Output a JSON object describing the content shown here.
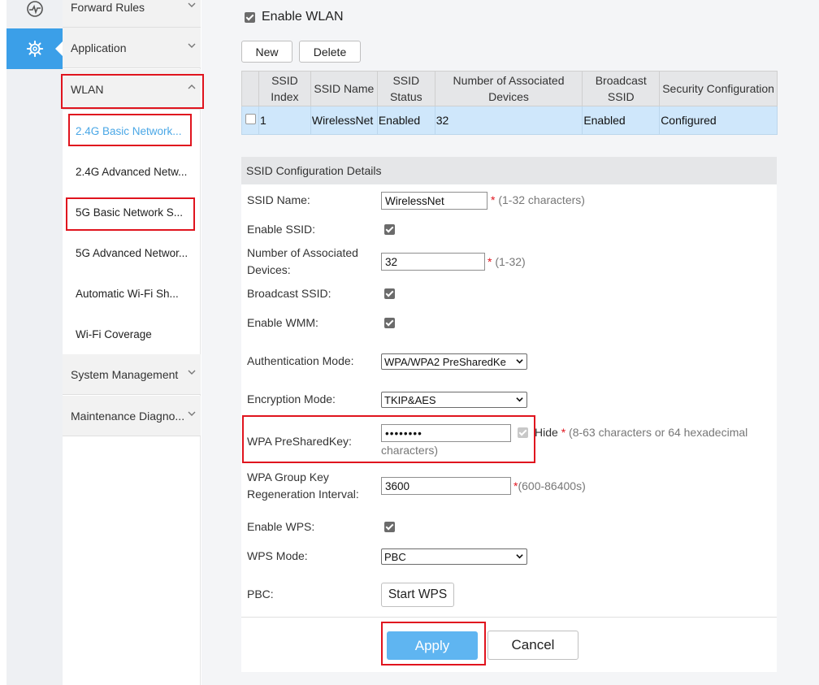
{
  "rail": {
    "items": [
      {
        "icon": "monitor-wave-icon"
      },
      {
        "icon": "gear-icon",
        "active": true
      }
    ]
  },
  "menu": {
    "groups": [
      {
        "label": "Forward Rules",
        "expanded": false
      },
      {
        "label": "Application",
        "expanded": false
      },
      {
        "label": "WLAN",
        "expanded": true
      },
      {
        "label": "System Management",
        "expanded": false
      },
      {
        "label": "Maintenance Diagno...",
        "expanded": false
      }
    ],
    "wlan_items": [
      {
        "label": "2.4G Basic Network...",
        "active": true
      },
      {
        "label": "2.4G Advanced Netw..."
      },
      {
        "label": "5G Basic Network S..."
      },
      {
        "label": "5G Advanced Networ..."
      },
      {
        "label": "Automatic Wi-Fi Sh..."
      },
      {
        "label": "Wi-Fi Coverage"
      }
    ]
  },
  "enable_wlan": {
    "label": "Enable WLAN",
    "checked": true
  },
  "toolbar": {
    "new_label": "New",
    "delete_label": "Delete"
  },
  "table": {
    "headers": [
      "",
      "SSID Index",
      "SSID Name",
      "SSID Status",
      "Number of Associated Devices",
      "Broadcast SSID",
      "Security Configuration"
    ],
    "rows": [
      [
        "",
        "1",
        "WirelessNet",
        "Enabled",
        "32",
        "Enabled",
        "Configured"
      ]
    ]
  },
  "details": {
    "title": "SSID Configuration Details",
    "ssid_name": {
      "label": "SSID Name:",
      "value": "WirelessNet",
      "star": "*",
      "hint": " (1-32 characters)"
    },
    "enable_ssid": {
      "label": "Enable SSID:",
      "checked": true
    },
    "assoc_devices": {
      "label": "Number of Associated Devices:",
      "value": "32",
      "star": "*",
      "hint": " (1-32)"
    },
    "broadcast_ssid": {
      "label": "Broadcast SSID:",
      "checked": true
    },
    "enable_wmm": {
      "label": "Enable WMM:",
      "checked": true
    },
    "auth_mode": {
      "label": "Authentication Mode:",
      "value": "WPA/WPA2 PreSharedKe"
    },
    "encryption_mode": {
      "label": "Encryption Mode:",
      "value": "TKIP&AES"
    },
    "psk": {
      "label": "WPA PreSharedKey:",
      "value": "••••••••",
      "hide_label": "Hide",
      "star": "*",
      "hint_line1": " (8-63 characters or 64 hexadecimal",
      "hint_line2": "characters)"
    },
    "group_key": {
      "label_line1": "WPA Group Key",
      "label_line2": "Regeneration Interval:",
      "value": "3600",
      "star": "*",
      "hint": "(600-86400s)"
    },
    "enable_wps": {
      "label": "Enable WPS:",
      "checked": true
    },
    "wps_mode": {
      "label": "WPS Mode:",
      "value": "PBC"
    },
    "pbc": {
      "label": "PBC:",
      "button": "Start WPS"
    }
  },
  "actions": {
    "apply_label": "Apply",
    "cancel_label": "Cancel"
  },
  "colors": {
    "accent": "#3b9fe8",
    "apply": "#5fb5f1",
    "highlight": "#e0141e",
    "row_selected": "#cfe7fb"
  }
}
